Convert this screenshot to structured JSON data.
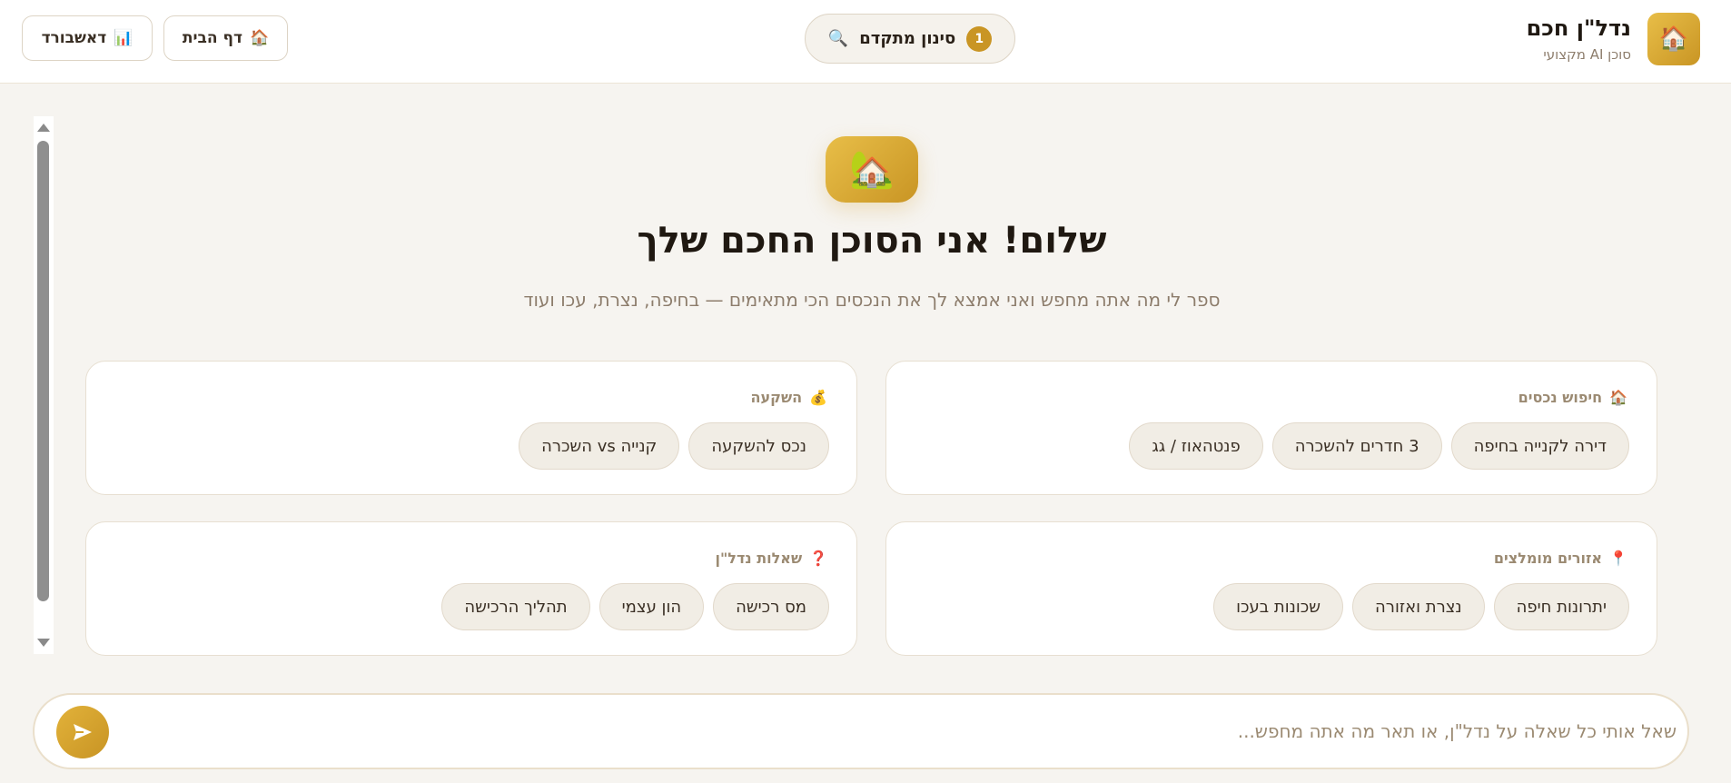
{
  "header": {
    "brand_title": "נדל\"ן חכם",
    "brand_subtitle": "סוכן AI מקצועי",
    "brand_icon": "house-icon",
    "filter_label": "סינון מתקדם",
    "filter_count": "1",
    "home_label": "דף הבית",
    "dashboard_label": "דאשבורד"
  },
  "hero": {
    "title": "שלום! אני הסוכן החכם שלך",
    "subtitle": "ספר לי מה אתה מחפש ואני אמצא לך את הנכסים הכי מתאימים — בחיפה, נצרת, עכו ועוד"
  },
  "cards": [
    {
      "title": "חיפוש נכסים",
      "icon": "house-icon",
      "chips": [
        "דירה לקנייה בחיפה",
        "3 חדרים להשכרה",
        "פנטהאוז / גג"
      ]
    },
    {
      "title": "השקעה",
      "icon": "money-bag-icon",
      "chips": [
        "נכס להשקעה",
        "קנייה vs השכרה"
      ]
    },
    {
      "title": "אזורים מומלצים",
      "icon": "pin-icon",
      "chips": [
        "יתרונות חיפה",
        "נצרת ואזורה",
        "שכונות בעכו"
      ]
    },
    {
      "title": "שאלות נדל\"ן",
      "icon": "question-icon",
      "chips": [
        "מס רכישה",
        "הון עצמי",
        "תהליך הרכישה"
      ]
    }
  ],
  "input": {
    "placeholder": "שאל אותי כל שאלה על נדל\"ן, או תאר מה אתה מחפש..."
  },
  "colors": {
    "accent": "#c99524",
    "background": "#f6f4f0"
  }
}
